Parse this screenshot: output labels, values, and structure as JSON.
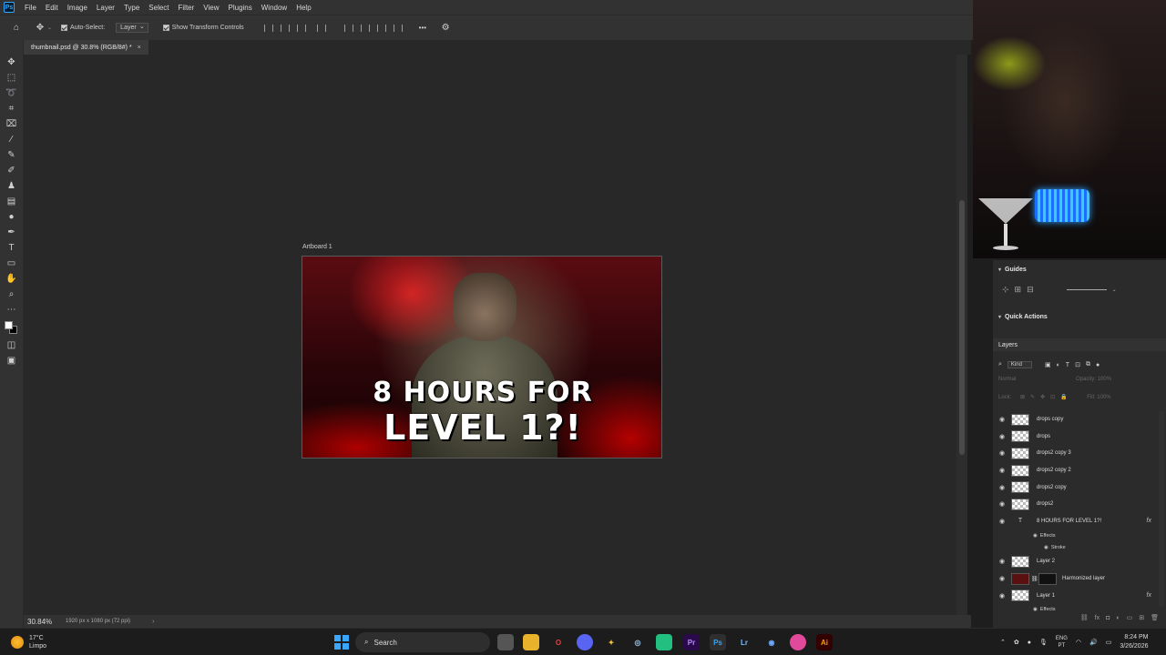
{
  "app": {
    "logo": "Ps",
    "menu": [
      "File",
      "Edit",
      "Image",
      "Layer",
      "Type",
      "Select",
      "Filter",
      "View",
      "Plugins",
      "Window",
      "Help"
    ]
  },
  "options": {
    "auto_select_label": "Auto-Select:",
    "auto_select_value": "Layer",
    "show_transform_label": "Show Transform Controls",
    "more_label": "•••"
  },
  "document": {
    "tab_title": "thumbnail.psd @ 30.8% (RGB/8#) *",
    "close": "×",
    "artboard_label": "Artboard 1",
    "headline_line1": "8 HOURS FOR",
    "headline_line2": "LEVEL 1?!"
  },
  "status": {
    "zoom": "30.84%",
    "dims": "1920 px x 1080 px (72 ppi)",
    "chevron": "›"
  },
  "panels": {
    "guides": "Guides",
    "quick_actions": "Quick Actions",
    "layers": "Layers",
    "kind": "Kind",
    "blend": "Normal",
    "opacity": "Opacity: 100%",
    "lock": "Lock:",
    "fill": "Fill: 100%",
    "layers_list": [
      {
        "name": "drops copy"
      },
      {
        "name": "drops"
      },
      {
        "name": "drops2 copy 3"
      },
      {
        "name": "drops2 copy 2"
      },
      {
        "name": "drops2 copy"
      },
      {
        "name": "drops2"
      }
    ],
    "text_layer": "8 HOURS FOR LEVEL 1?!",
    "effects_label": "Effects",
    "stroke_label": "Stroke",
    "layer2": "Layer 2",
    "harmonized": "Harmonized layer",
    "layer1": "Layer 1",
    "effects_label2": "Effects",
    "fx": "fx"
  },
  "taskbar": {
    "temp": "17°C",
    "condition": "Limpo",
    "search": "Search",
    "lang1": "ENG",
    "lang2": "PT",
    "time": "8:24 PM",
    "date": "3/26/2026"
  },
  "colors": {
    "accent": "#31a8ff",
    "menubar": "#323232",
    "canvas": "#282828"
  }
}
